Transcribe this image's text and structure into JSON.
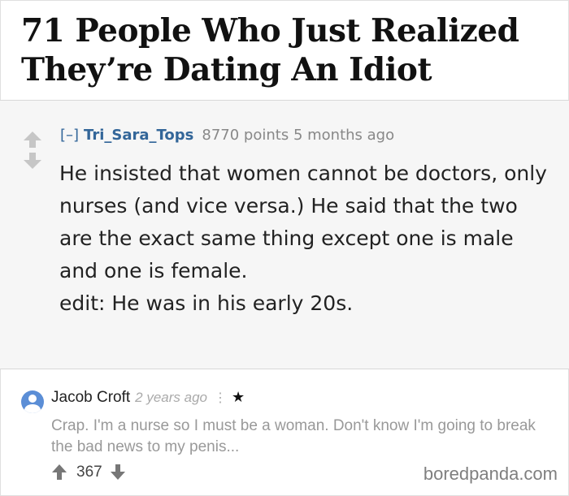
{
  "article": {
    "title": "71 People Who Just Realized They’re Dating An Idiot"
  },
  "reddit_comment": {
    "collapse": "[–]",
    "author": "Tri_Sara_Tops",
    "points": "8770 points",
    "age": "5 months ago",
    "lines": [
      "He insisted that women cannot be doctors, only nurses (and vice versa.) He said that the two are the exact same thing except one is male and one is female.",
      "edit: He was in his early 20s."
    ]
  },
  "reply": {
    "author": "Jacob Croft",
    "age": "2 years ago",
    "dots": "⋮",
    "star": "★",
    "text": "Crap. I'm a nurse so I must be a woman. Don't know I'm going to break the bad news to my penis...",
    "votes": "367"
  },
  "watermark": "boredpanda.com",
  "colors": {
    "link": "#336699",
    "reddit_bg": "#f6f6f6",
    "avatar": "#5b8ed6"
  }
}
